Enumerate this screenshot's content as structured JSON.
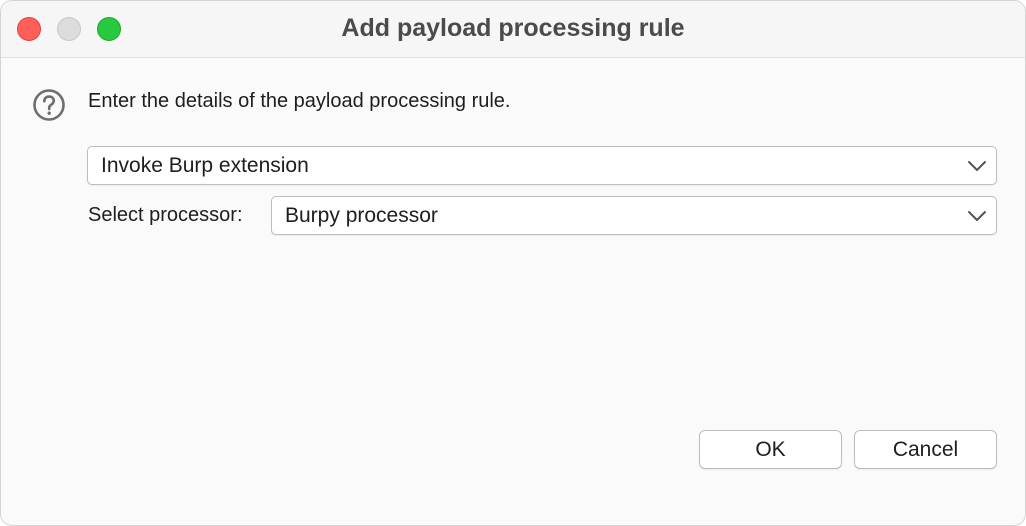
{
  "window": {
    "title": "Add payload processing rule"
  },
  "dialog": {
    "prompt": "Enter the details of the payload processing rule.",
    "rule_type": {
      "selected": "Invoke Burp extension"
    },
    "processor": {
      "label": "Select processor:",
      "selected": "Burpy processor"
    }
  },
  "buttons": {
    "ok_label": "OK",
    "cancel_label": "Cancel"
  },
  "icons": {
    "help": "question-circle-icon",
    "dropdown": "chevron-down-icon"
  },
  "colors": {
    "close": "#fe5f57",
    "minimize": "#dcdcdc",
    "maximize": "#28c840"
  }
}
